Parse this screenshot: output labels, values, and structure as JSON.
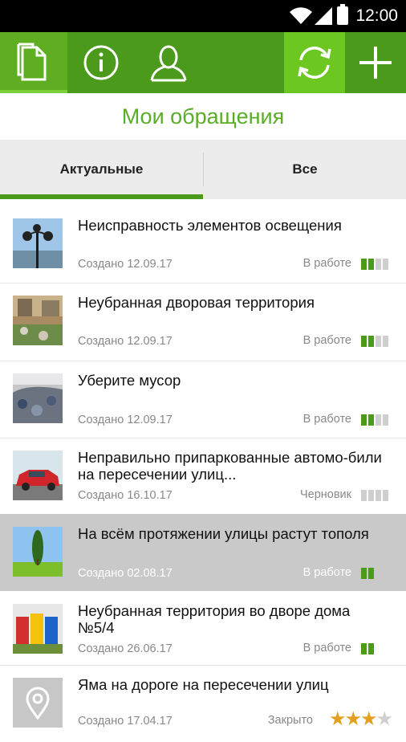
{
  "status_bar": {
    "time": "12:00"
  },
  "toolbar": {
    "buttons": [
      {
        "name": "requests-icon"
      },
      {
        "name": "info-icon"
      },
      {
        "name": "profile-icon"
      },
      {
        "name": "refresh-icon"
      },
      {
        "name": "add-icon"
      }
    ],
    "colors": {
      "bar": "#4c9a1c",
      "active": "#5fae22",
      "refresh": "#6cc820"
    }
  },
  "page_title": "Мои обращения",
  "tabs": [
    {
      "label": "Актуальные",
      "selected": true
    },
    {
      "label": "Все",
      "selected": false
    }
  ],
  "requests": [
    {
      "title": "Неисправность элементов освещения",
      "date": "Создано 12.09.17",
      "status": "В работе",
      "progress": {
        "filled": 2,
        "total": 4
      }
    },
    {
      "title": "Неубранная дворовая территория",
      "date": "Создано 12.09.17",
      "status": "В работе",
      "progress": {
        "filled": 2,
        "total": 4
      }
    },
    {
      "title": "Уберите мусор",
      "date": "Создано 12.09.17",
      "status": "В работе",
      "progress": {
        "filled": 2,
        "total": 4
      }
    },
    {
      "title": "Неправильно припаркованные автомо-били на пересечении улиц...",
      "date": "Создано 16.10.17",
      "status": "Черновик",
      "progress": {
        "filled": 0,
        "total": 4
      }
    },
    {
      "title": "На всём протяжении улицы растут тополя",
      "date": "Создано 02.08.17",
      "status": "В работе",
      "progress": {
        "filled": 2,
        "total": 4
      }
    },
    {
      "title": "Неубранная территория во дворе дома №5/4",
      "date": "Создано 26.06.17",
      "status": "В работе",
      "progress": {
        "filled": 2,
        "total": 4
      }
    },
    {
      "title": "Яма на дороге на пересечении улиц",
      "date": "Создано 17.04.17",
      "status": "Закрыто",
      "rating": {
        "value": 3,
        "max": 4
      }
    }
  ]
}
